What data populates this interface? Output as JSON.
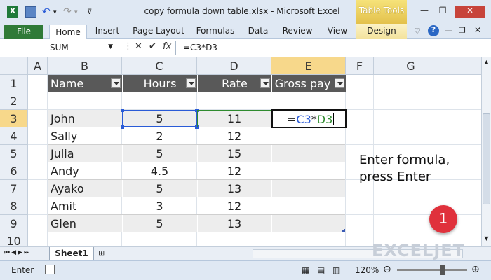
{
  "window": {
    "title": "copy formula down table.xlsx - Microsoft Excel",
    "context_tab_group": "Table Tools"
  },
  "ribbon": {
    "tabs": [
      "File",
      "Home",
      "Insert",
      "Page Layout",
      "Formulas",
      "Data",
      "Review",
      "View",
      "Design"
    ]
  },
  "formula_bar": {
    "name_box": "SUM",
    "formula": "=C3*D3"
  },
  "grid": {
    "columns": [
      "A",
      "B",
      "C",
      "D",
      "E",
      "F",
      "G"
    ],
    "rows": [
      "1",
      "2",
      "3",
      "4",
      "5",
      "6",
      "7",
      "8",
      "9",
      "10"
    ],
    "selected_column": "E",
    "selected_row": "3"
  },
  "table": {
    "headers": [
      "Name",
      "Hours",
      "Rate",
      "Gross pay"
    ],
    "rows": [
      [
        "John",
        "5",
        "11"
      ],
      [
        "Sally",
        "2",
        "12"
      ],
      [
        "Julia",
        "5",
        "15"
      ],
      [
        "Andy",
        "4.5",
        "12"
      ],
      [
        "Ayako",
        "5",
        "13"
      ],
      [
        "Amit",
        "3",
        "12"
      ],
      [
        "Glen",
        "5",
        "13"
      ]
    ],
    "editing_cell": {
      "eq": "=",
      "ref1": "C3",
      "op": "*",
      "ref2": "D3"
    }
  },
  "annotation": {
    "line1": "Enter formula,",
    "line2": "press Enter",
    "step": "1"
  },
  "sheet_tabs": {
    "active": "Sheet1"
  },
  "status_bar": {
    "mode": "Enter",
    "zoom": "120%",
    "watermark": "EXCELJET"
  },
  "colors": {
    "ref1_color": "#2a5bd7",
    "ref2_color": "#2e8b2e",
    "table_header": "#595959",
    "band": "#ededed",
    "selected_header": "#f7d88b",
    "badge": "#e0313c"
  }
}
